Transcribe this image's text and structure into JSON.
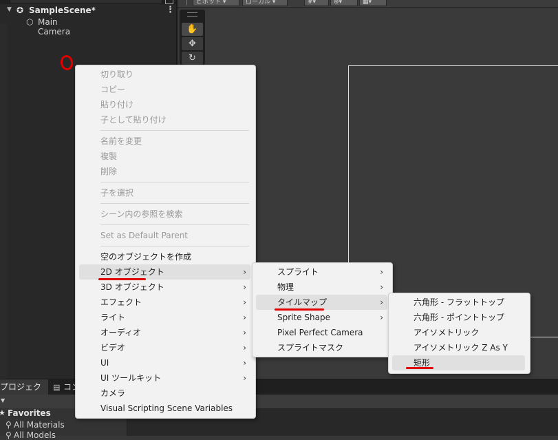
{
  "hierarchy": {
    "scene_name": "SampleScene*",
    "scene_icon": "unity-scene-icon",
    "scene_menu_icon": "⋮",
    "items": [
      {
        "label": "Main Camera",
        "icon": "gameobject-cube-icon"
      }
    ]
  },
  "scene_toolbar": {
    "pivot_label": "ピボット",
    "local_label": "ローカル"
  },
  "tools": [
    "hand-tool",
    "move-tool",
    "rotate-tool"
  ],
  "context_menu": {
    "items": [
      {
        "label": "切り取り",
        "enabled": false
      },
      {
        "label": "コピー",
        "enabled": false
      },
      {
        "label": "貼り付け",
        "enabled": false
      },
      {
        "label": "子として貼り付け",
        "enabled": false
      },
      {
        "label": "名前を変更",
        "enabled": false
      },
      {
        "label": "複製",
        "enabled": false
      },
      {
        "label": "削除",
        "enabled": false
      },
      {
        "label": "子を選択",
        "enabled": false
      },
      {
        "label": "シーン内の参照を検索",
        "enabled": false
      },
      {
        "label": "Set as Default Parent",
        "enabled": false
      },
      {
        "label": "空のオブジェクトを作成",
        "enabled": true
      },
      {
        "label": "2D オブジェクト",
        "enabled": true,
        "submenu": true,
        "highlighted": true
      },
      {
        "label": "3D オブジェクト",
        "enabled": true,
        "submenu": true
      },
      {
        "label": "エフェクト",
        "enabled": true,
        "submenu": true
      },
      {
        "label": "ライト",
        "enabled": true,
        "submenu": true
      },
      {
        "label": "オーディオ",
        "enabled": true,
        "submenu": true
      },
      {
        "label": "ビデオ",
        "enabled": true,
        "submenu": true
      },
      {
        "label": "UI",
        "enabled": true,
        "submenu": true
      },
      {
        "label": "UI ツールキット",
        "enabled": true,
        "submenu": true
      },
      {
        "label": "カメラ",
        "enabled": true
      },
      {
        "label": "Visual Scripting Scene Variables",
        "enabled": true
      }
    ]
  },
  "submenu_2d": {
    "items": [
      {
        "label": "スプライト",
        "submenu": true
      },
      {
        "label": "物理",
        "submenu": true
      },
      {
        "label": "タイルマップ",
        "submenu": true,
        "highlighted": true
      },
      {
        "label": "Sprite Shape",
        "submenu": true
      },
      {
        "label": "Pixel Perfect Camera"
      },
      {
        "label": "スプライトマスク"
      }
    ]
  },
  "submenu_tilemap": {
    "items": [
      {
        "label": "六角形 - フラットトップ"
      },
      {
        "label": "六角形 - ポイントトップ"
      },
      {
        "label": "アイソメトリック"
      },
      {
        "label": "アイソメトリック Z As Y"
      },
      {
        "label": "矩形",
        "highlighted": true
      }
    ]
  },
  "project_panel": {
    "tabs": [
      "プロジェクト",
      "コンソール"
    ],
    "favorites_label": "Favorites",
    "favorites": [
      "All Materials",
      "All Models"
    ]
  },
  "colors": {
    "annotation_red": "#e00000",
    "menu_bg": "#f2f2f2",
    "menu_highlight": "#e0e0e0",
    "editor_bg": "#383838",
    "hierarchy_bg": "#282828"
  }
}
